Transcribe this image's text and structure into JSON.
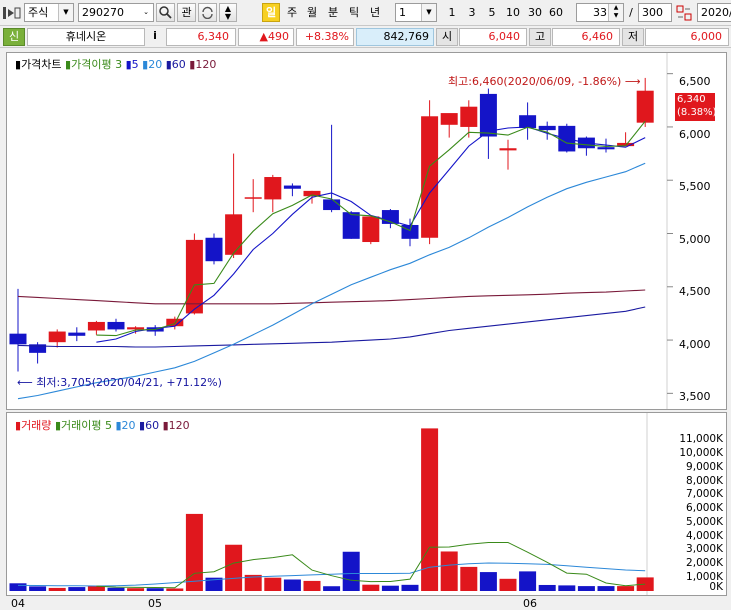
{
  "toolbar": {
    "market": "주식",
    "code": "290270",
    "kwan": "관",
    "day_tab": "일",
    "period_tabs": [
      "주",
      "월",
      "분",
      "틱",
      "년"
    ],
    "interval_value": "1",
    "interval_buttons": [
      "1",
      "3",
      "5",
      "10",
      "30",
      "60"
    ],
    "count_value": "33",
    "slash": "/",
    "total_value": "300",
    "date_value": "2020/"
  },
  "info": {
    "badge": "신",
    "name": "휴네시온",
    "info_icon_label": "i",
    "price": "6,340",
    "change": "▲490",
    "change_pct": "+8.38%",
    "volume": "842,769",
    "open_label": "시",
    "open": "6,040",
    "high_label": "고",
    "high": "6,460",
    "low_label": "저",
    "low": "6,000"
  },
  "colors": {
    "up": "#e0171d",
    "down": "#1414c8",
    "ma5": "#3a8a1a",
    "ma20": "#2c88d8",
    "ma60": "#1a1aa0",
    "ma120": "#7a1a3a"
  },
  "price_panel": {
    "legend": {
      "main": "가격차트",
      "ma_label": "가격이평",
      "ma1": "3",
      "ma2": "5",
      "ma3": "20",
      "ma4": "60",
      "ma5": "120"
    },
    "high_note": "최고:6,460(2020/06/09, -1.86%)",
    "low_note": "최저:3,705(2020/04/21, +71.12%)",
    "current_price": "6,340",
    "current_pct": "(8.38%)",
    "axis": [
      "6,500",
      "6,000",
      "5,500",
      "5,000",
      "4,500",
      "4,000",
      "3,500"
    ]
  },
  "volume_panel": {
    "legend": {
      "main": "거래량",
      "ma_label": "거래이평",
      "ma1": "5",
      "ma2": "20",
      "ma3": "60",
      "ma4": "120"
    },
    "axis": [
      "11,000K",
      "10,000K",
      "9,000K",
      "8,000K",
      "7,000K",
      "6,000K",
      "5,000K",
      "4,000K",
      "3,000K",
      "2,000K",
      "1,000K",
      "0K"
    ]
  },
  "x_axis": [
    "04",
    "05",
    "06"
  ],
  "chart_data": {
    "type": "candlestick",
    "price_ylim": [
      3400,
      6600
    ],
    "volume_ylim": [
      0,
      11700
    ],
    "candles": [
      {
        "o": 4060,
        "h": 4480,
        "l": 3705,
        "c": 3960
      },
      {
        "o": 3960,
        "h": 3980,
        "l": 3780,
        "c": 3880
      },
      {
        "o": 3980,
        "h": 4100,
        "l": 3930,
        "c": 4080
      },
      {
        "o": 4070,
        "h": 4120,
        "l": 3990,
        "c": 4040
      },
      {
        "o": 4090,
        "h": 4180,
        "l": 4050,
        "c": 4170
      },
      {
        "o": 4170,
        "h": 4200,
        "l": 4080,
        "c": 4100
      },
      {
        "o": 4100,
        "h": 4130,
        "l": 4060,
        "c": 4120
      },
      {
        "o": 4120,
        "h": 4140,
        "l": 4040,
        "c": 4080
      },
      {
        "o": 4130,
        "h": 4220,
        "l": 4100,
        "c": 4200
      },
      {
        "o": 4250,
        "h": 5000,
        "l": 4240,
        "c": 4940
      },
      {
        "o": 4960,
        "h": 5000,
        "l": 4710,
        "c": 4740
      },
      {
        "o": 4800,
        "h": 5750,
        "l": 4770,
        "c": 5180
      },
      {
        "o": 5330,
        "h": 5510,
        "l": 5200,
        "c": 5340
      },
      {
        "o": 5320,
        "h": 5550,
        "l": 5200,
        "c": 5530
      },
      {
        "o": 5450,
        "h": 5470,
        "l": 5350,
        "c": 5420
      },
      {
        "o": 5350,
        "h": 5400,
        "l": 5280,
        "c": 5400
      },
      {
        "o": 5320,
        "h": 6020,
        "l": 5200,
        "c": 5220
      },
      {
        "o": 5200,
        "h": 5210,
        "l": 4950,
        "c": 4950
      },
      {
        "o": 4920,
        "h": 5160,
        "l": 4900,
        "c": 5160
      },
      {
        "o": 5220,
        "h": 5230,
        "l": 5050,
        "c": 5090
      },
      {
        "o": 5080,
        "h": 5140,
        "l": 4880,
        "c": 4950
      },
      {
        "o": 4960,
        "h": 6250,
        "l": 4900,
        "c": 6100
      },
      {
        "o": 6020,
        "h": 6120,
        "l": 5900,
        "c": 6130
      },
      {
        "o": 6000,
        "h": 6250,
        "l": 5900,
        "c": 6190
      },
      {
        "o": 6310,
        "h": 6360,
        "l": 5700,
        "c": 5910
      },
      {
        "o": 5780,
        "h": 5880,
        "l": 5600,
        "c": 5800
      },
      {
        "o": 6110,
        "h": 6230,
        "l": 5880,
        "c": 5990
      },
      {
        "o": 6010,
        "h": 6050,
        "l": 5880,
        "c": 5970
      },
      {
        "o": 6010,
        "h": 6030,
        "l": 5760,
        "c": 5770
      },
      {
        "o": 5900,
        "h": 5910,
        "l": 5730,
        "c": 5800
      },
      {
        "o": 5810,
        "h": 5890,
        "l": 5760,
        "c": 5790
      },
      {
        "o": 5820,
        "h": 5950,
        "l": 5820,
        "c": 5850
      },
      {
        "o": 6040,
        "h": 6460,
        "l": 6000,
        "c": 6340
      }
    ],
    "volumes": [
      550,
      330,
      220,
      280,
      360,
      230,
      200,
      200,
      180,
      5500,
      950,
      3300,
      1150,
      950,
      820,
      720,
      340,
      2800,
      450,
      380,
      440,
      11600,
      2820,
      1720,
      1350,
      870,
      1400,
      430,
      400,
      350,
      350,
      350,
      970
    ],
    "ma5": [
      null,
      null,
      null,
      null,
      3980,
      4010,
      4080,
      4110,
      4130,
      4290,
      4420,
      4620,
      4850,
      5000,
      5180,
      5340,
      5380,
      5300,
      5170,
      5120,
      5070,
      5380,
      5600,
      5820,
      5960,
      5990,
      6000,
      5940,
      5890,
      5850,
      5830,
      5810,
      5900
    ],
    "ma20": [
      3450,
      3480,
      3520,
      3560,
      3600,
      3630,
      3660,
      3700,
      3740,
      3800,
      3880,
      3960,
      4050,
      4140,
      4240,
      4340,
      4430,
      4520,
      4590,
      4660,
      4720,
      4800,
      4870,
      4960,
      5060,
      5150,
      5250,
      5340,
      5420,
      5480,
      5530,
      5580,
      5660
    ],
    "ma60": [
      3950,
      3945,
      3940,
      3940,
      3940,
      3940,
      3935,
      3935,
      3940,
      3945,
      3950,
      3955,
      3960,
      3965,
      3970,
      3975,
      3980,
      3990,
      4000,
      4010,
      4030,
      4060,
      4090,
      4110,
      4130,
      4150,
      4170,
      4190,
      4210,
      4230,
      4250,
      4270,
      4310
    ],
    "ma120": [
      4410,
      4400,
      4390,
      4380,
      4370,
      4360,
      4350,
      4340,
      4340,
      4340,
      4340,
      4340,
      4340,
      4340,
      4345,
      4350,
      4355,
      4360,
      4365,
      4370,
      4380,
      4390,
      4400,
      4410,
      4415,
      4420,
      4425,
      4430,
      4440,
      4445,
      4450,
      4460,
      4470
    ],
    "vma5": [
      null,
      null,
      null,
      null,
      350,
      280,
      260,
      250,
      230,
      1260,
      1380,
      1990,
      2240,
      2380,
      2580,
      1490,
      1090,
      760,
      670,
      680,
      850,
      3120,
      3140,
      3330,
      3460,
      3460,
      2770,
      2050,
      1280,
      1200,
      570,
      380,
      490
    ],
    "vma20": [
      400,
      390,
      380,
      370,
      360,
      380,
      420,
      500,
      600,
      700,
      800,
      900,
      1000,
      1050,
      1100,
      1150,
      1200,
      1250,
      1250,
      1250,
      1270,
      1700,
      1850,
      1950,
      2000,
      1980,
      1950,
      1900,
      1800,
      1700,
      1600,
      1500,
      1450
    ]
  }
}
